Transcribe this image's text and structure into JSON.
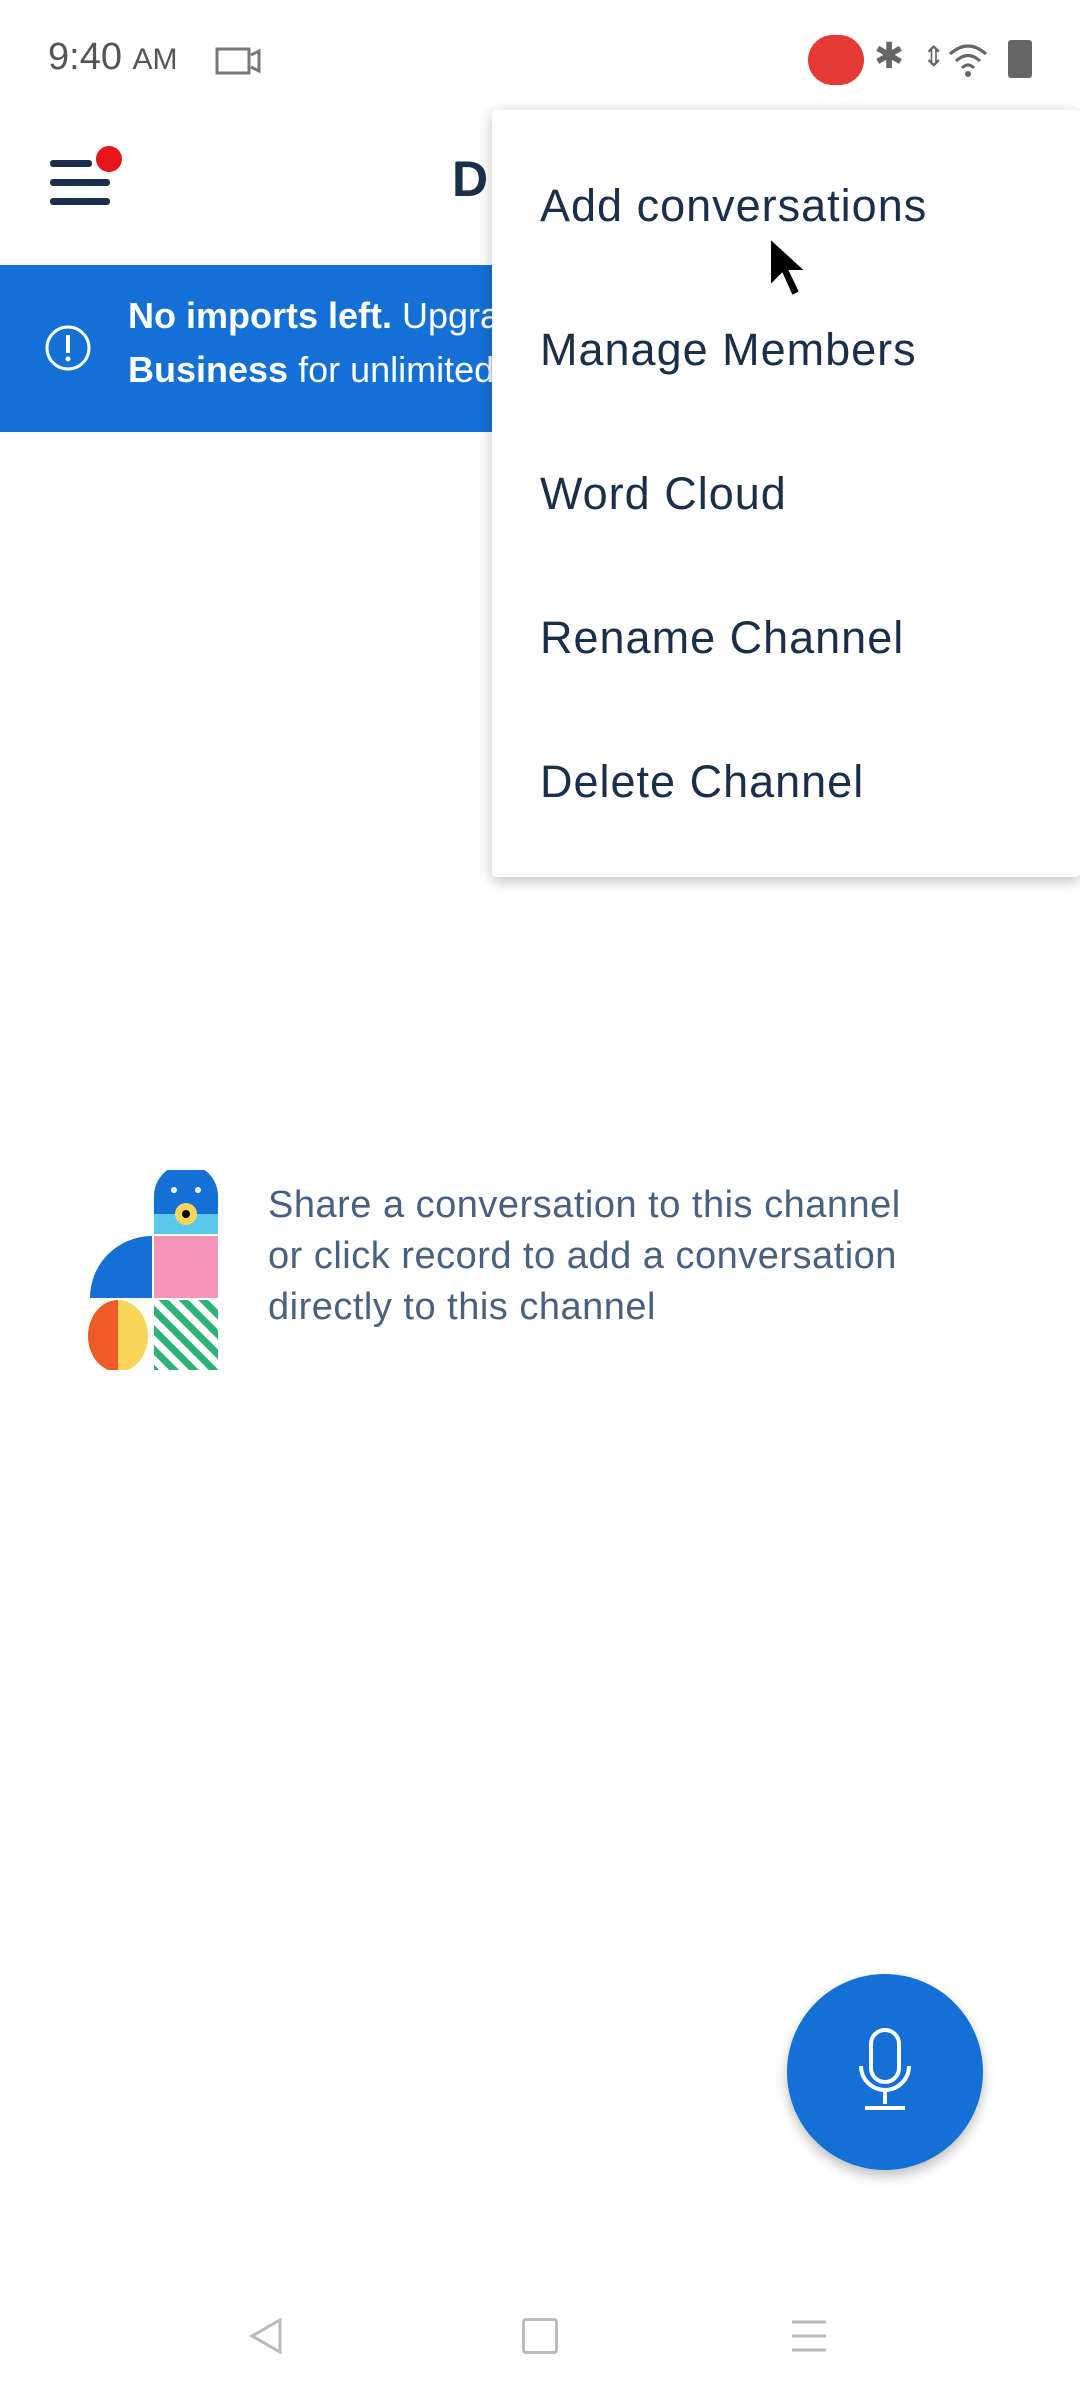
{
  "status_bar": {
    "time": "9:40",
    "ampm": "AM"
  },
  "header": {
    "title_partial": "D"
  },
  "banner": {
    "bold": "No imports left.",
    "text1": " Upgrade to",
    "bold2": "Business",
    "text2": " for unlimited"
  },
  "menu": {
    "items": [
      {
        "label": "Add conversations"
      },
      {
        "label": "Manage Members"
      },
      {
        "label": "Word Cloud"
      },
      {
        "label": "Rename Channel"
      },
      {
        "label": "Delete Channel"
      }
    ]
  },
  "empty_state": {
    "line1": "Share a conversation to this channel",
    "line2": "or click record to add a conversation",
    "line3": "directly to this channel"
  },
  "colors": {
    "accent": "#1570d6",
    "notification_dot": "#e8141e",
    "recording": "#e53935"
  }
}
